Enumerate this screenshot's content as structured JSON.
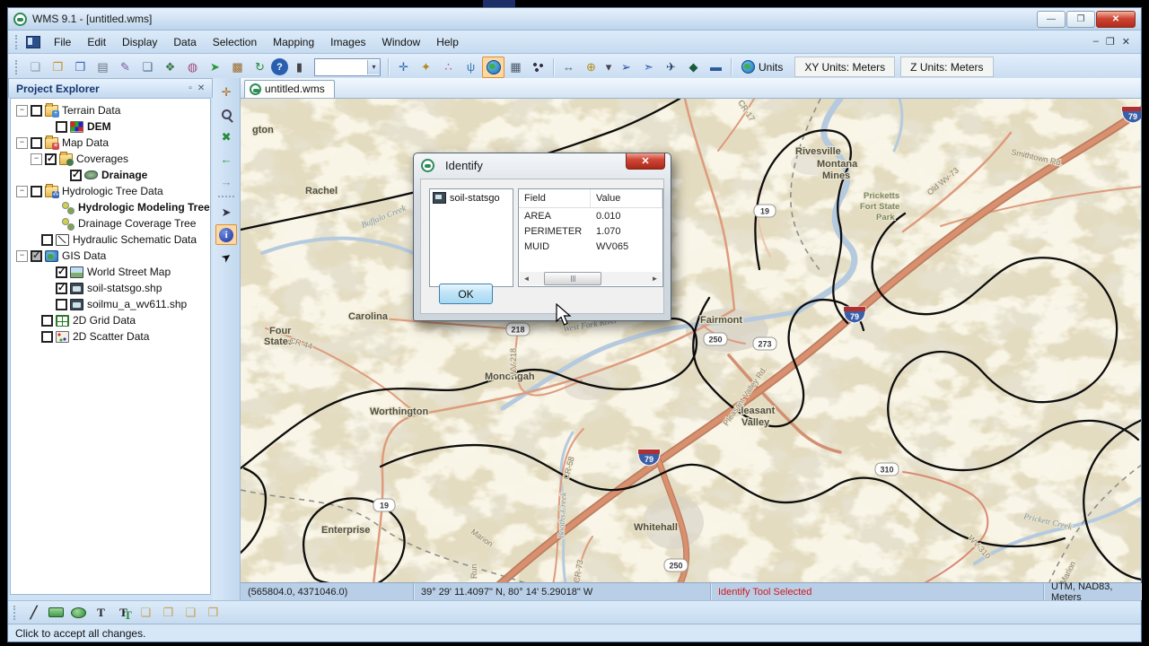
{
  "window": {
    "title": "WMS 9.1 - [untitled.wms]"
  },
  "menu": {
    "items": [
      "File",
      "Edit",
      "Display",
      "Data",
      "Selection",
      "Mapping",
      "Images",
      "Window",
      "Help"
    ]
  },
  "toolbar": {
    "combo_value": "",
    "units_label": "Units",
    "xy_units": "XY Units: Meters",
    "z_units": "Z Units: Meters"
  },
  "icons": {
    "minimize": "—",
    "restore": "❐",
    "close": "✕",
    "mdi_min": "–",
    "mdi_restore": "❐",
    "mdi_close": "✕",
    "new": "❏",
    "open": "❐",
    "save": "❒",
    "print": "▤",
    "feather": "✎",
    "layout": "❑",
    "frame": "❖",
    "display_opts": "◍",
    "run": "➤",
    "properties": "▩",
    "refresh": "↻",
    "help": "?",
    "delete": "▮",
    "combo_arrow": "▾",
    "move": "✛",
    "north": "✦",
    "nodes": "∴",
    "branch": "ψ",
    "grid": "▦",
    "measure": "↔",
    "add_layer": "⊕",
    "drop": "▾",
    "digitize": "➢",
    "convert": "➣",
    "flight": "✈",
    "export": "◆",
    "bucket": "▬",
    "pan": "✛",
    "extents": "✖",
    "back": "←",
    "fwd": "→",
    "selmap": "➤",
    "pointer": "➤",
    "expander_minus": "−",
    "exp_min": "▫",
    "exp_close": "✕",
    "line": "╱",
    "text": "T",
    "textsel": "T",
    "front": "❏",
    "back2": "❐",
    "fwd2": "❑",
    "bwd2": "❒",
    "hs_left": "◄",
    "hs_right": "►"
  },
  "project_explorer": {
    "title": "Project Explorer",
    "items": [
      {
        "label": "Terrain Data"
      },
      {
        "label": "DEM"
      },
      {
        "label": "Map Data"
      },
      {
        "label": "Coverages"
      },
      {
        "label": "Drainage"
      },
      {
        "label": "Hydrologic Tree Data"
      },
      {
        "label": "Hydrologic Modeling Tree"
      },
      {
        "label": "Drainage Coverage Tree"
      },
      {
        "label": "Hydraulic Schematic Data"
      },
      {
        "label": "GIS Data"
      },
      {
        "label": "World Street Map"
      },
      {
        "label": "soil-statsgo.shp"
      },
      {
        "label": "soilmu_a_wv611.shp"
      },
      {
        "label": "2D Grid Data"
      },
      {
        "label": "2D Scatter Data"
      }
    ]
  },
  "map_tab": {
    "label": "untitled.wms"
  },
  "identify_dialog": {
    "title": "Identify",
    "layer": "soil-statsgo",
    "table": {
      "headers": [
        "Field",
        "Value"
      ],
      "rows": [
        [
          "AREA",
          "0.010"
        ],
        [
          "PERIMETER",
          "1.070"
        ],
        [
          "MUID",
          "WV065"
        ]
      ]
    },
    "ok_label": "OK"
  },
  "map": {
    "labels": [
      {
        "t": "gton"
      },
      {
        "t": "Rachel"
      },
      {
        "t": "Buffalo Creek"
      },
      {
        "t": "Four"
      },
      {
        "t": "States"
      },
      {
        "t": "Carolina"
      },
      {
        "t": "Monongah"
      },
      {
        "t": "Worthington"
      },
      {
        "t": "West Fork River"
      },
      {
        "t": "Enterprise"
      },
      {
        "t": "Marion"
      },
      {
        "t": "Run"
      },
      {
        "t": "Booths Creek"
      },
      {
        "t": "CR-58"
      },
      {
        "t": "CR-73"
      },
      {
        "t": "Whitehall"
      },
      {
        "t": "Fairmont"
      },
      {
        "t": "Pleasant"
      },
      {
        "t": "Valley"
      },
      {
        "t": "Pleasant Valley Rd."
      },
      {
        "t": "Rivesville"
      },
      {
        "t": "Montana"
      },
      {
        "t": "Mines"
      },
      {
        "t": "Pricketts"
      },
      {
        "t": "Fort State"
      },
      {
        "t": "Park"
      },
      {
        "t": "Old Wv-73"
      },
      {
        "t": "Smithtown Rd."
      },
      {
        "t": "CR-17"
      },
      {
        "t": "CR-44"
      },
      {
        "t": "WV-218"
      },
      {
        "t": "WV-310"
      },
      {
        "t": "Prickett Creek"
      },
      {
        "t": "Marion"
      }
    ],
    "shields": [
      {
        "n": "19"
      },
      {
        "n": "218"
      },
      {
        "n": "250"
      },
      {
        "n": "273"
      },
      {
        "n": "250"
      },
      {
        "n": "19"
      },
      {
        "n": "310"
      }
    ],
    "interstates": [
      {
        "n": "79"
      },
      {
        "n": "79"
      },
      {
        "n": "79"
      }
    ]
  },
  "map_statusbar": {
    "coords": "(565804.0, 4371046.0)",
    "latlon": "39° 29' 11.4097\" N, 80° 14' 5.29018\" W",
    "tool": "Identify Tool Selected",
    "projection": "UTM, NAD83, Meters"
  },
  "statusbar": {
    "message": "Click to accept all changes."
  }
}
